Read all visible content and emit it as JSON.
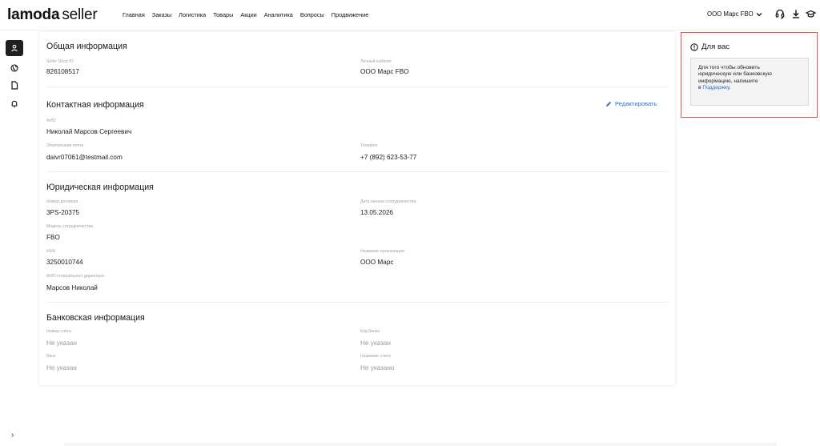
{
  "header": {
    "logo_bold": "lamoda",
    "logo_suffix": "seller",
    "nav": [
      "Главная",
      "Заказы",
      "Логистика",
      "Товары",
      "Акции",
      "Аналитика",
      "Вопросы",
      "Продвижение"
    ],
    "account_name": "ООО Марс FBO",
    "icons": [
      "headset-icon",
      "download-icon",
      "graduation-cap-icon"
    ]
  },
  "sidebar": {
    "items": [
      "user-icon",
      "globe-icon",
      "document-icon",
      "bell-icon"
    ],
    "expand_glyph": "›"
  },
  "general": {
    "title": "Общая информация",
    "shop_id_label": "Seller Shop ID",
    "shop_id": "826108517",
    "cabinet_label": "Личный кабинет",
    "cabinet": "ООО Марс FBO"
  },
  "contact": {
    "title": "Контактная информация",
    "edit_label": "Редактировать",
    "fio_label": "ФИО",
    "fio": "Николай Марсов Сергеевич",
    "email_label": "Электронная почта",
    "email": "daivr07061@testmail.com",
    "phone_label": "Телефон",
    "phone": "+7 (892) 623-53-77"
  },
  "legal": {
    "title": "Юридическая информация",
    "contract_label": "Номер договора",
    "contract": "3PS-20375",
    "start_date_label": "Дата начала сотрудничества",
    "start_date": "13.05.2026",
    "model_label": "Модель сотрудничества",
    "model": "FBO",
    "inn_label": "ИНН",
    "inn": "3250010744",
    "org_label": "Название организации",
    "org": "ООО Марс",
    "ceo_label": "ФИО генерального директора",
    "ceo": "Марсов Николай"
  },
  "bank": {
    "title": "Банковская информация",
    "account_label": "Номер счёта",
    "account": "Не указан",
    "bank_code_label": "Код банка",
    "bank_code": "Не указан",
    "bank_label": "Банк",
    "bank": "Не указан",
    "account_name_label": "Название счета",
    "account_name": "Не указано"
  },
  "side_panel": {
    "title": "Для вас",
    "notice_line1": "Для того чтобы обновить",
    "notice_line2": "юридическую или банковскую",
    "notice_line3": "информацию, напишите",
    "notice_prefix": "в ",
    "notice_link": "Поддержку",
    "notice_suffix": "."
  },
  "colors": {
    "accent": "#2d6ed6",
    "highlight_border": "#e05541",
    "sidebar_active": "#1f1f1f"
  }
}
